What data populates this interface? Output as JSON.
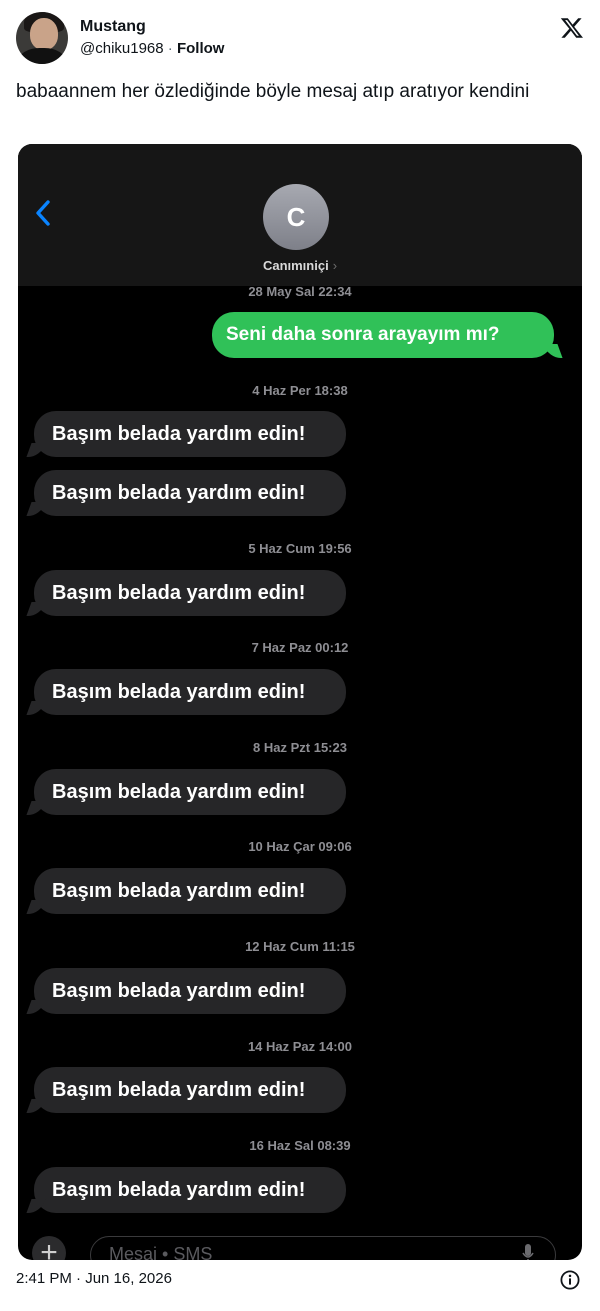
{
  "tweet": {
    "author_name": "Mustang",
    "handle": "@chiku1968",
    "separator": "·",
    "follow_label": "Follow",
    "text": "babaannem her özlediğinde böyle mesaj atıp aratıyor kendini",
    "timestamp": "2:41 PM · Jun 16, 2026"
  },
  "chat": {
    "contact_initial": "C",
    "contact_name": "Canımıniçi",
    "contact_chevron": "›",
    "composer_placeholder": "Mesaj • SMS",
    "composer_plus": "+",
    "outgoing": {
      "time": "28 May Sal 22:34",
      "text": "Seni daha sonra arayayım mı?"
    },
    "incoming": [
      {
        "time": "4 Haz Per 18:38",
        "text": "Başım belada yardım edin!"
      },
      {
        "time": "",
        "text": "Başım belada yardım edin!"
      },
      {
        "time": "5 Haz Cum 19:56",
        "text": "Başım belada yardım edin!"
      },
      {
        "time": "7 Haz Paz 00:12",
        "text": "Başım belada yardım edin!"
      },
      {
        "time": "8 Haz Pzt 15:23",
        "text": "Başım belada yardım edin!"
      },
      {
        "time": "10 Haz Çar 09:06",
        "text": "Başım belada yardım edin!"
      },
      {
        "time": "12 Haz Cum 11:15",
        "text": "Başım belada yardım edin!"
      },
      {
        "time": "14 Haz Paz 14:00",
        "text": "Başım belada yardım edin!"
      },
      {
        "time": "16 Haz Sal 08:39",
        "text": "Başım belada yardım edin!"
      }
    ]
  },
  "colors": {
    "outgoing_bubble": "#30c158",
    "incoming_bubble": "#262628",
    "ios_blue": "#0a84ff"
  },
  "icons": [
    "x-logo-icon",
    "back-chevron-icon",
    "plus-icon",
    "mic-icon",
    "info-icon"
  ]
}
